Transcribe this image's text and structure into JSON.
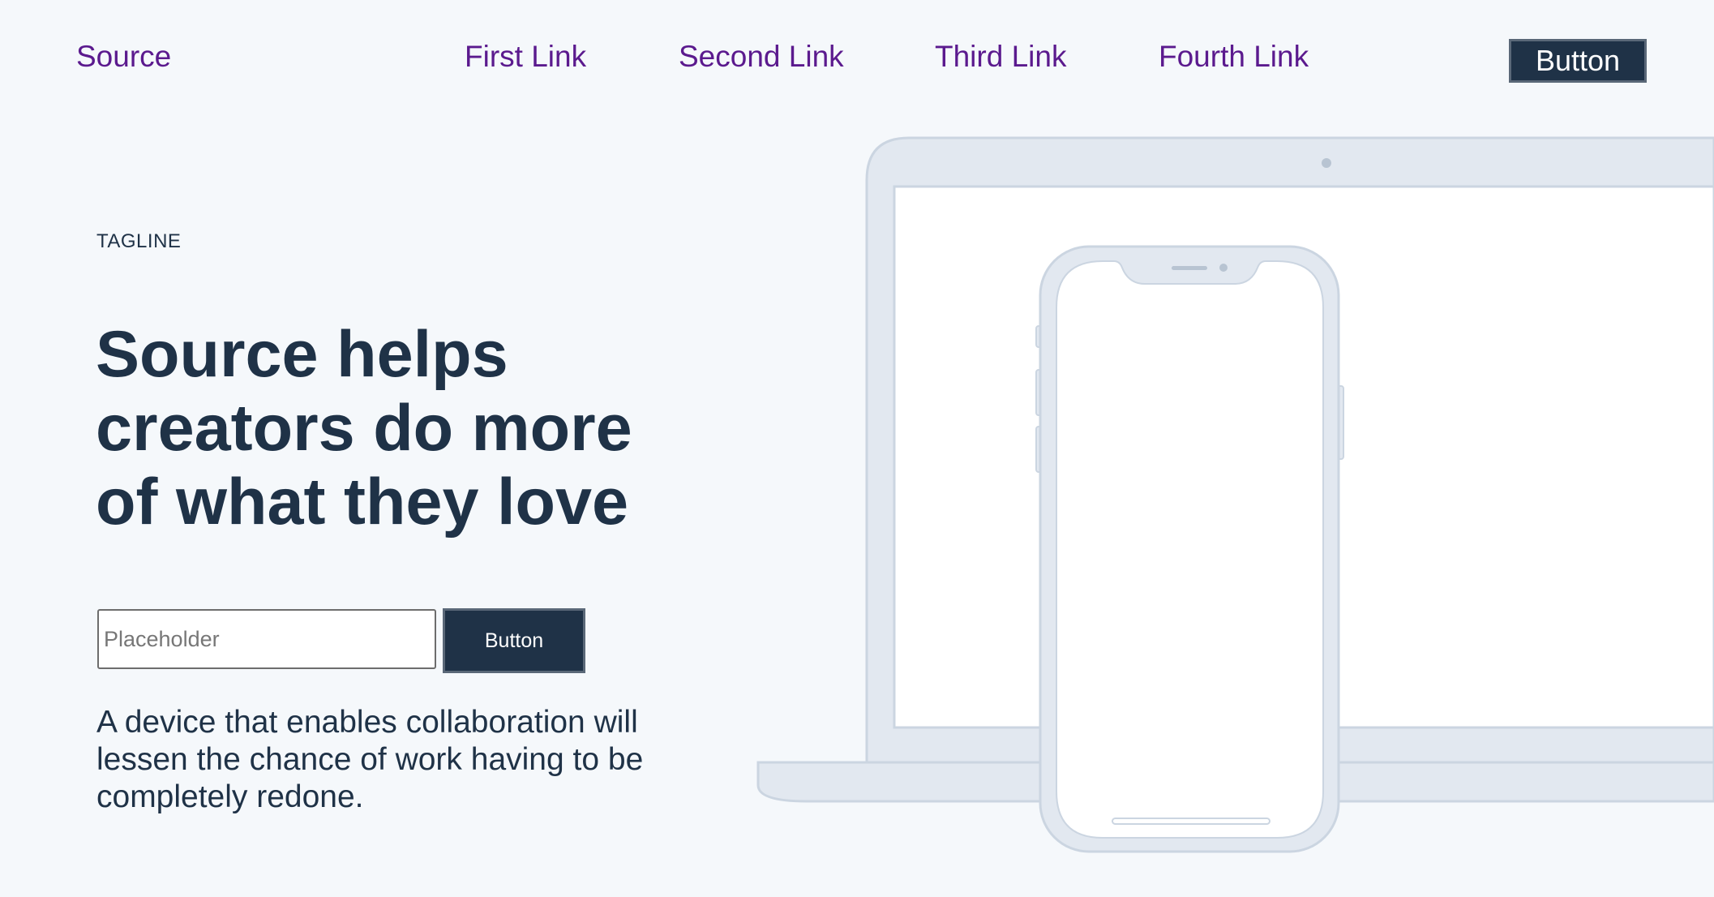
{
  "header": {
    "brand": "Source",
    "nav_links": [
      "First Link",
      "Second Link",
      "Third Link",
      "Fourth Link"
    ],
    "cta_label": "Button"
  },
  "hero": {
    "tagline": "TAGLINE",
    "headline": "Source helps creators do more of what they love",
    "signup": {
      "placeholder": "Placeholder",
      "button_label": "Button"
    },
    "description": "A device that enables collaboration will lessen the chance of work having to be completely redone."
  },
  "illustration": {
    "devices": [
      "laptop",
      "phone"
    ],
    "colors": {
      "device_fill": "#e2e8f0",
      "device_stroke": "#cbd5e1",
      "screen": "#ffffff",
      "accent": "#94a3b8"
    }
  },
  "colors": {
    "background": "#f5f8fb",
    "text": "#1f3247",
    "link": "#5b1a8e",
    "button_bg": "#1f3247",
    "button_text": "#ffffff"
  }
}
